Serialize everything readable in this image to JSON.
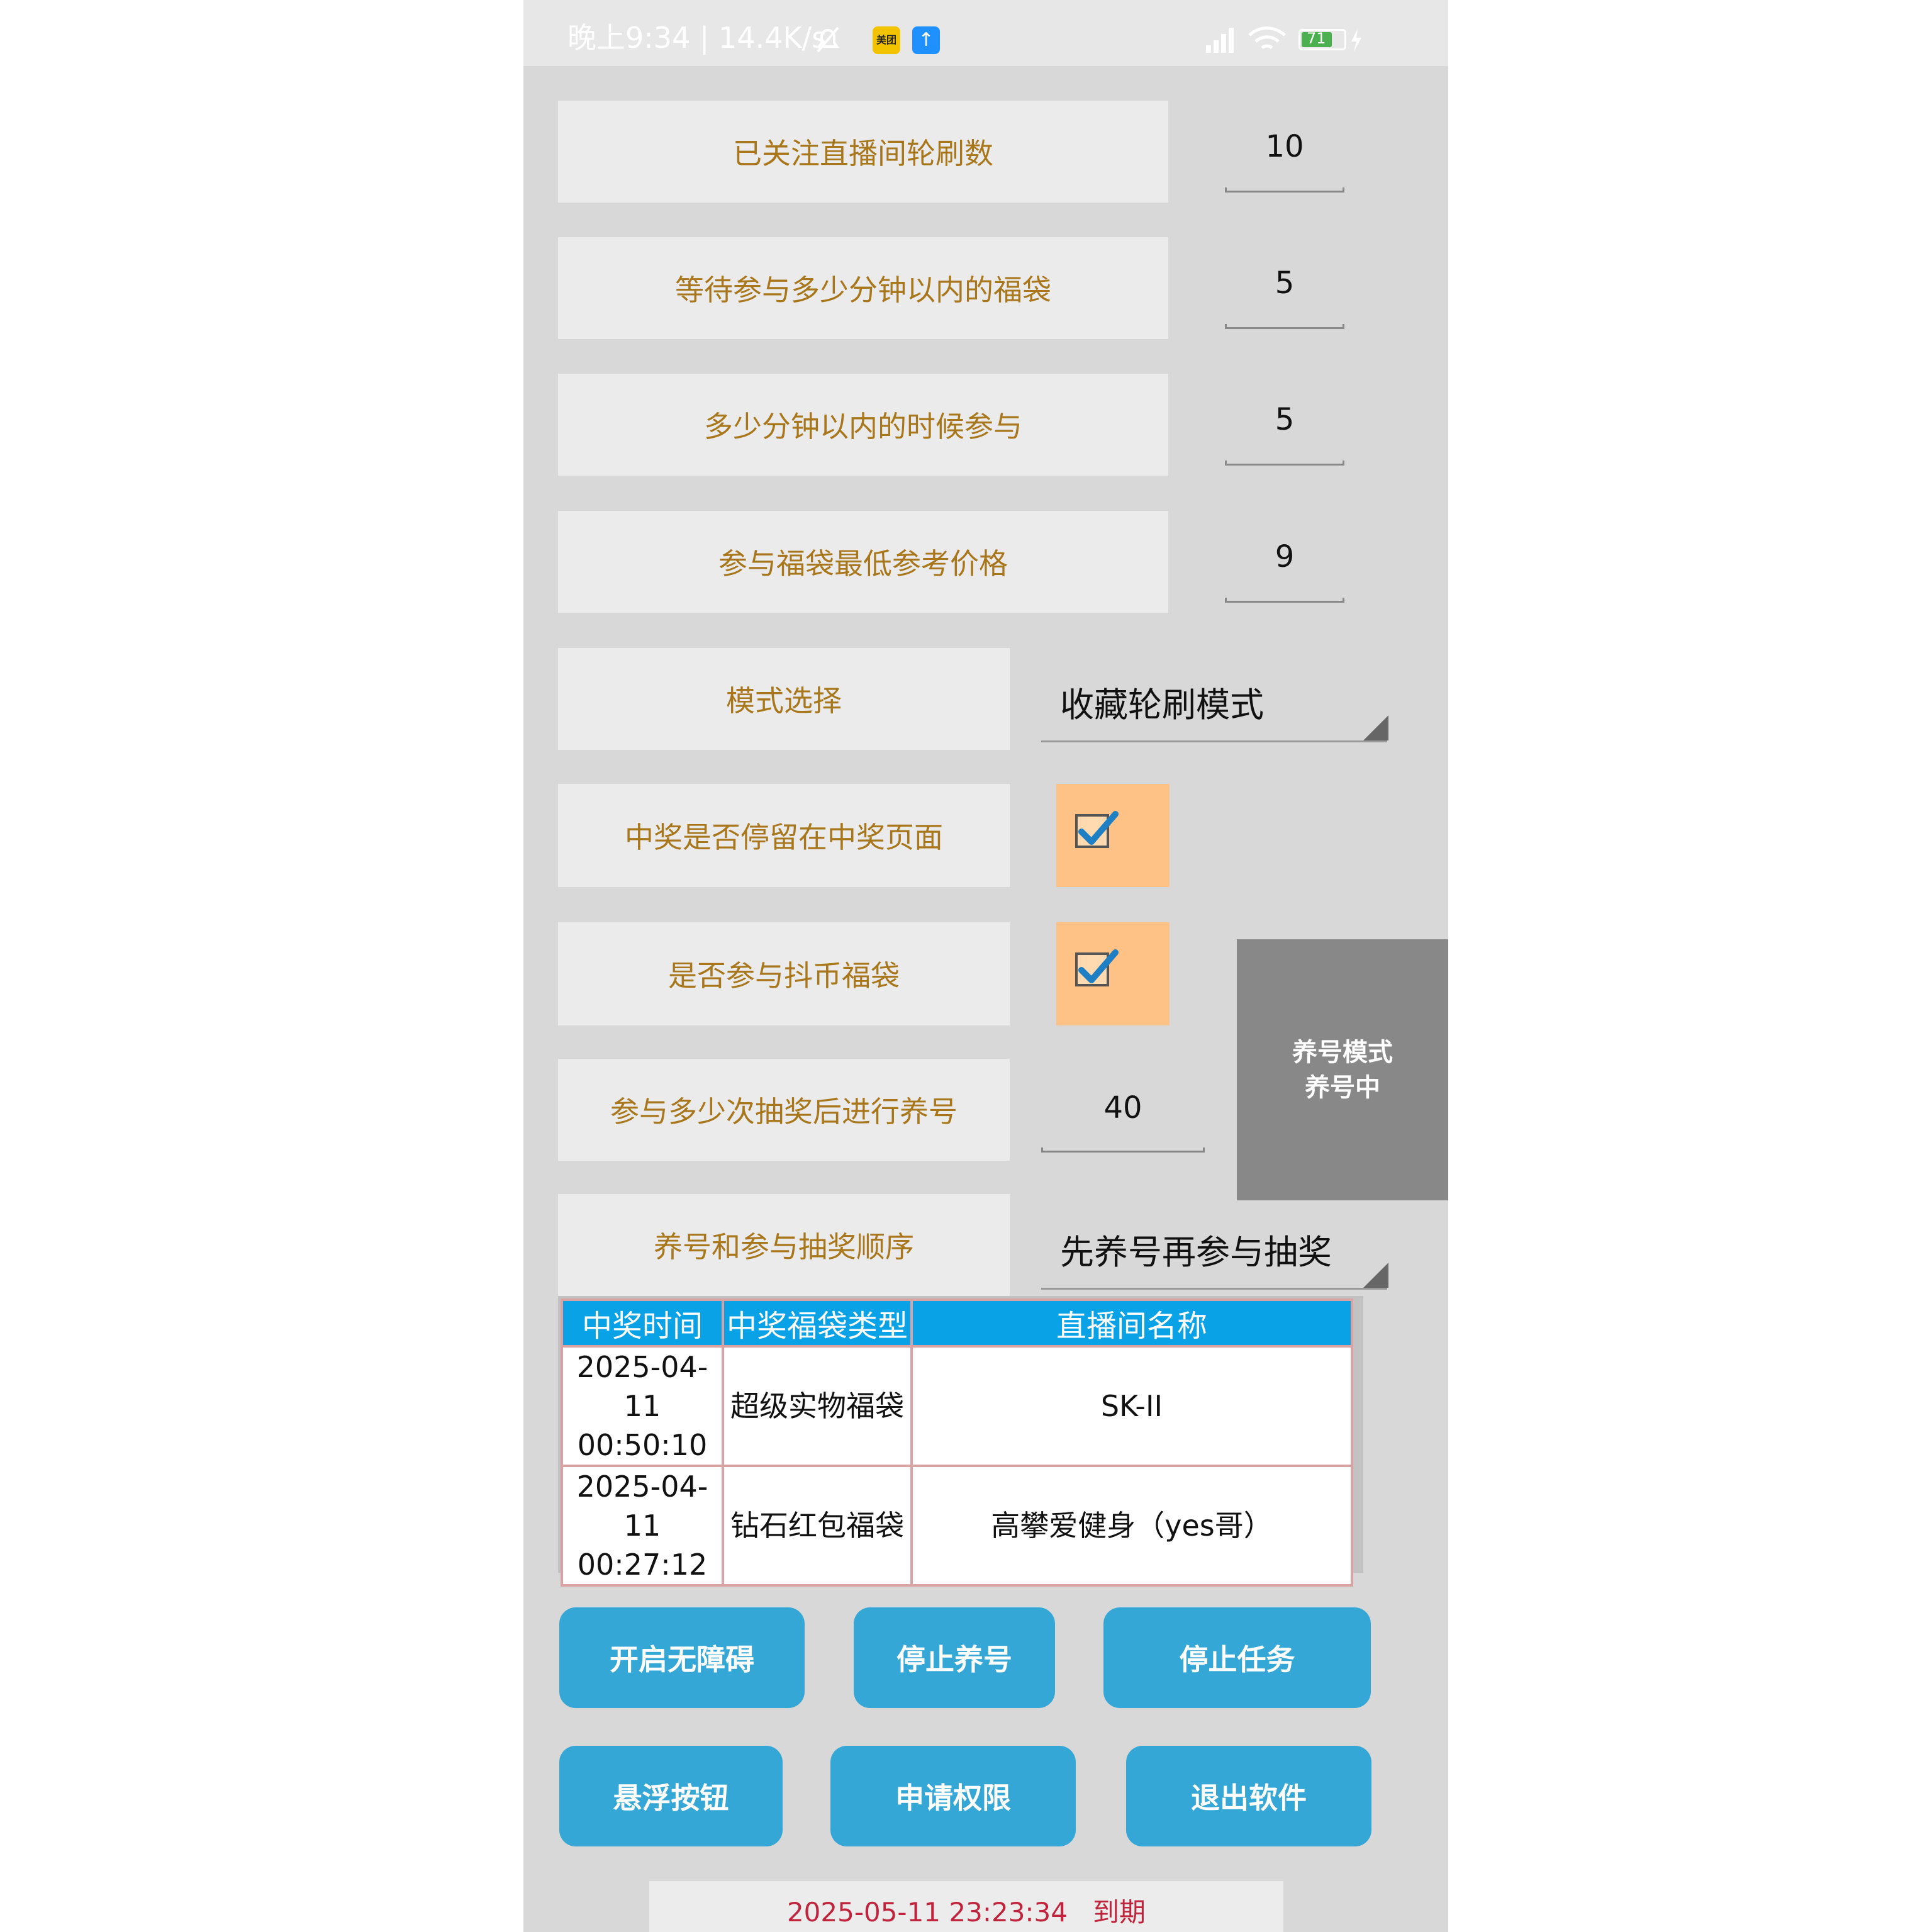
{
  "status_bar": {
    "text": "晚上9:34 | 14.4K/s",
    "meituan_badge": "美团",
    "battery": "71"
  },
  "settings": {
    "followed_rounds": {
      "label": "已关注直播间轮刷数",
      "value": "10"
    },
    "wait_minutes": {
      "label": "等待参与多少分钟以内的福袋",
      "value": "5"
    },
    "join_within_minutes": {
      "label": "多少分钟以内的时候参与",
      "value": "5"
    },
    "min_price": {
      "label": "参与福袋最低参考价格",
      "value": "9"
    },
    "mode": {
      "label": "模式选择",
      "value": "收藏轮刷模式"
    },
    "stay_on_win": {
      "label": "中奖是否停留在中奖页面",
      "checked": true
    },
    "join_coin_bag": {
      "label": "是否参与抖币福袋",
      "checked": true
    },
    "nurture_after": {
      "label": "参与多少次抽奖后进行养号",
      "value": "40"
    },
    "order": {
      "label": "养号和参与抽奖顺序",
      "value": "先养号再参与抽奖"
    }
  },
  "nurture_button": {
    "line1": "养号模式",
    "line2": "养号中"
  },
  "win_table": {
    "headers": [
      "中奖时间",
      "中奖福袋类型",
      "直播间名称"
    ],
    "rows": [
      {
        "date": "2025-04-11",
        "time": "00:50:10",
        "type": "超级实物福袋",
        "room": "SK-II"
      },
      {
        "date": "2025-04-11",
        "time": "00:27:12",
        "type": "钻石红包福袋",
        "room": "高攀爱健身（yes哥）"
      }
    ]
  },
  "buttons": {
    "accessibility": "开启无障碍",
    "stop_nurture": "停止养号",
    "stop_task": "停止任务",
    "float_button": "悬浮按钮",
    "request_permission": "申请权限",
    "exit_app": "退出软件"
  },
  "footer": {
    "expiry": "2025-05-11 23:23:34   到期"
  },
  "colors": {
    "label_text": "#a9771b",
    "button_blue": "#35a7d6",
    "header_blue": "#0aa2e6",
    "checkbox_bg": "#ffc286",
    "footer_red": "#c0243c"
  }
}
